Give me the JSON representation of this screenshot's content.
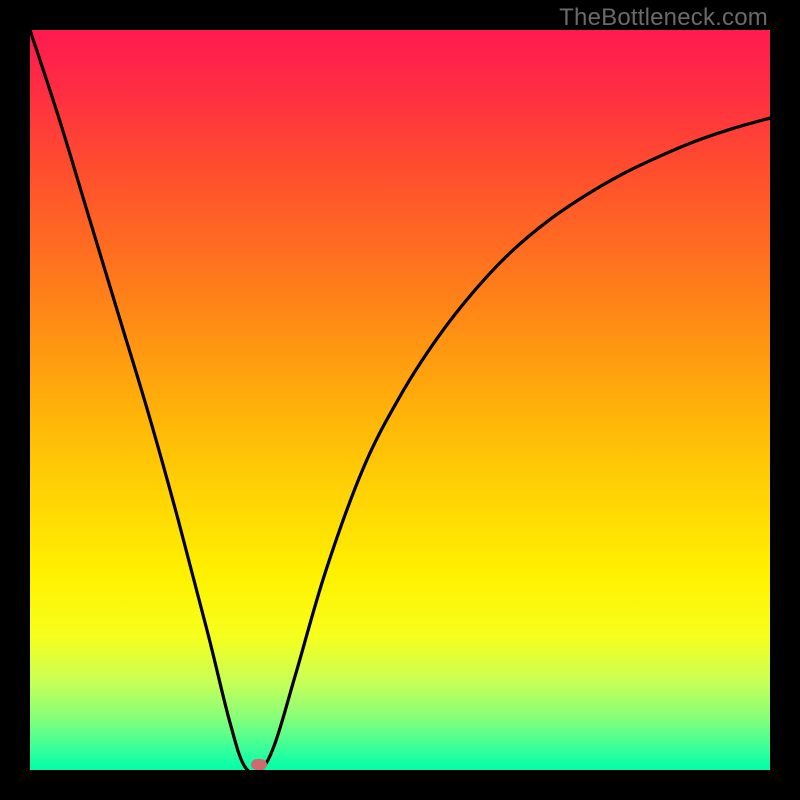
{
  "watermark": "TheBottleneck.com",
  "colors": {
    "frame": "#000000",
    "curve": "#000000",
    "marker": "#cf6a6f",
    "gradient_top": "#ff1a50",
    "gradient_bottom": "#00ffa8"
  },
  "chart_data": {
    "type": "line",
    "title": "",
    "xlabel": "",
    "ylabel": "",
    "xlim": [
      0,
      100
    ],
    "ylim": [
      0,
      100
    ],
    "grid": false,
    "x": [
      0,
      4,
      8,
      12,
      16,
      20,
      24,
      27,
      29,
      31,
      33,
      36,
      40,
      45,
      50,
      55,
      60,
      65,
      70,
      75,
      80,
      85,
      90,
      95,
      100
    ],
    "values": [
      100,
      87.8,
      74.6,
      61.4,
      48.2,
      33.9,
      18.6,
      6.5,
      0.5,
      0,
      3.3,
      13.3,
      27.0,
      40.7,
      50.5,
      58.3,
      64.7,
      70.0,
      74.2,
      77.6,
      80.5,
      82.9,
      85.0,
      86.7,
      88.1
    ],
    "minimum_x": 31,
    "series": [
      {
        "name": "main-curve",
        "x_ref": "x",
        "values_ref": "values"
      }
    ],
    "annotations": [
      {
        "type": "marker",
        "x": 31,
        "y": 0,
        "shape": "rounded-rect"
      }
    ]
  }
}
